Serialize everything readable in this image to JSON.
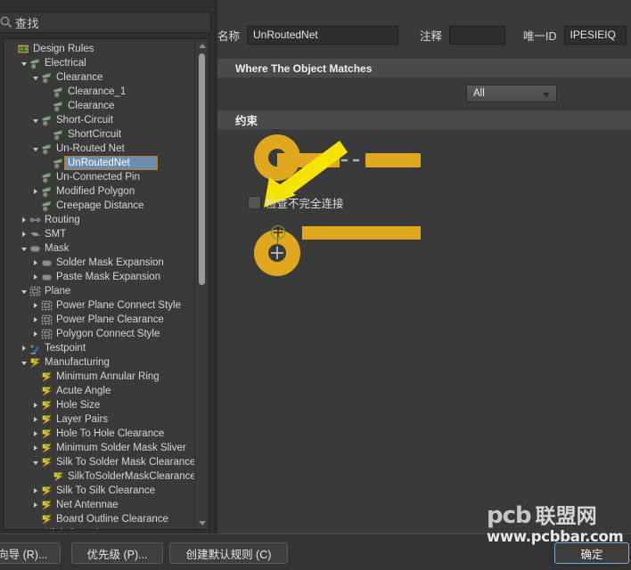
{
  "search": {
    "placeholder": "查找",
    "icon": "search-icon"
  },
  "tree": {
    "nodes": [
      {
        "label": "Design Rules",
        "depth": 0,
        "twisty": "none",
        "icon": "design-rules-folder-icon",
        "selected": false
      },
      {
        "label": "Electrical",
        "depth": 1,
        "twisty": "open",
        "icon": "electrical-rule-icon",
        "selected": false
      },
      {
        "label": "Clearance",
        "depth": 2,
        "twisty": "open",
        "icon": "electrical-rule-icon",
        "selected": false
      },
      {
        "label": "Clearance_1",
        "depth": 3,
        "twisty": "none",
        "icon": "electrical-rule-icon",
        "selected": false
      },
      {
        "label": "Clearance",
        "depth": 3,
        "twisty": "none",
        "icon": "electrical-rule-icon",
        "selected": false
      },
      {
        "label": "Short-Circuit",
        "depth": 2,
        "twisty": "open",
        "icon": "electrical-rule-icon",
        "selected": false
      },
      {
        "label": "ShortCircuit",
        "depth": 3,
        "twisty": "none",
        "icon": "electrical-rule-icon",
        "selected": false
      },
      {
        "label": "Un-Routed Net",
        "depth": 2,
        "twisty": "open",
        "icon": "electrical-rule-icon",
        "selected": false
      },
      {
        "label": "UnRoutedNet",
        "depth": 3,
        "twisty": "none",
        "icon": "electrical-rule-icon",
        "selected": true
      },
      {
        "label": "Un-Connected Pin",
        "depth": 2,
        "twisty": "none",
        "icon": "electrical-rule-icon",
        "selected": false
      },
      {
        "label": "Modified Polygon",
        "depth": 2,
        "twisty": "closed",
        "icon": "electrical-rule-icon",
        "selected": false
      },
      {
        "label": "Creepage Distance",
        "depth": 2,
        "twisty": "none",
        "icon": "electrical-rule-icon",
        "selected": false
      },
      {
        "label": "Routing",
        "depth": 1,
        "twisty": "closed",
        "icon": "routing-icon",
        "selected": false
      },
      {
        "label": "SMT",
        "depth": 1,
        "twisty": "closed",
        "icon": "smt-icon",
        "selected": false
      },
      {
        "label": "Mask",
        "depth": 1,
        "twisty": "open",
        "icon": "mask-icon",
        "selected": false
      },
      {
        "label": "Solder Mask Expansion",
        "depth": 2,
        "twisty": "closed",
        "icon": "mask-icon",
        "selected": false
      },
      {
        "label": "Paste Mask Expansion",
        "depth": 2,
        "twisty": "closed",
        "icon": "mask-icon",
        "selected": false
      },
      {
        "label": "Plane",
        "depth": 1,
        "twisty": "open",
        "icon": "plane-icon",
        "selected": false
      },
      {
        "label": "Power Plane Connect Style",
        "depth": 2,
        "twisty": "closed",
        "icon": "plane-icon",
        "selected": false
      },
      {
        "label": "Power Plane Clearance",
        "depth": 2,
        "twisty": "closed",
        "icon": "plane-icon",
        "selected": false
      },
      {
        "label": "Polygon Connect Style",
        "depth": 2,
        "twisty": "closed",
        "icon": "plane-icon",
        "selected": false
      },
      {
        "label": "Testpoint",
        "depth": 1,
        "twisty": "closed",
        "icon": "testpoint-icon",
        "selected": false
      },
      {
        "label": "Manufacturing",
        "depth": 1,
        "twisty": "open",
        "icon": "manufacturing-icon",
        "selected": false
      },
      {
        "label": "Minimum Annular Ring",
        "depth": 2,
        "twisty": "none",
        "icon": "manufacturing-icon",
        "selected": false
      },
      {
        "label": "Acute Angle",
        "depth": 2,
        "twisty": "none",
        "icon": "manufacturing-icon",
        "selected": false
      },
      {
        "label": "Hole Size",
        "depth": 2,
        "twisty": "closed",
        "icon": "manufacturing-icon",
        "selected": false
      },
      {
        "label": "Layer Pairs",
        "depth": 2,
        "twisty": "closed",
        "icon": "manufacturing-icon",
        "selected": false
      },
      {
        "label": "Hole To Hole Clearance",
        "depth": 2,
        "twisty": "closed",
        "icon": "manufacturing-icon",
        "selected": false
      },
      {
        "label": "Minimum Solder Mask Sliver",
        "depth": 2,
        "twisty": "closed",
        "icon": "manufacturing-icon",
        "selected": false
      },
      {
        "label": "Silk To Solder Mask Clearance",
        "depth": 2,
        "twisty": "open",
        "icon": "manufacturing-icon",
        "selected": false
      },
      {
        "label": "SilkToSolderMaskClearance",
        "depth": 3,
        "twisty": "none",
        "icon": "manufacturing-icon",
        "selected": false
      },
      {
        "label": "Silk To Silk Clearance",
        "depth": 2,
        "twisty": "closed",
        "icon": "manufacturing-icon",
        "selected": false
      },
      {
        "label": "Net Antennae",
        "depth": 2,
        "twisty": "closed",
        "icon": "manufacturing-icon",
        "selected": false
      },
      {
        "label": "Board Outline Clearance",
        "depth": 2,
        "twisty": "none",
        "icon": "manufacturing-icon",
        "selected": false
      },
      {
        "label": "High Speed",
        "depth": 1,
        "twisty": "closed",
        "icon": "highspeed-icon",
        "selected": false
      }
    ]
  },
  "form": {
    "name_label": "名称",
    "name_value": "UnRoutedNet",
    "comment_label": "注释",
    "comment_value": "",
    "uid_label": "唯一ID",
    "uid_value": "IPESIEIQ"
  },
  "sections": {
    "where_title": "Where The Object Matches",
    "scope_value": "All",
    "constraint_title": "约束"
  },
  "constraint": {
    "checkbox_label": "检查不完全连接",
    "checkbox_checked": false,
    "pcb_color": "#E0A81E",
    "arrow_color": "#F5E400",
    "connection_line_color": "#E03020",
    "marker_circle_color": "#6D9A3E"
  },
  "bottom": {
    "wizard_label": "则向导 (R)...",
    "priority_label": "优先级 (P)...",
    "default_label": "创建默认规则 (C)",
    "ok_label": "确定"
  },
  "watermark": {
    "brand": "pcb",
    "brand_cn": "联盟网",
    "url": "www.pcbbar.com"
  }
}
